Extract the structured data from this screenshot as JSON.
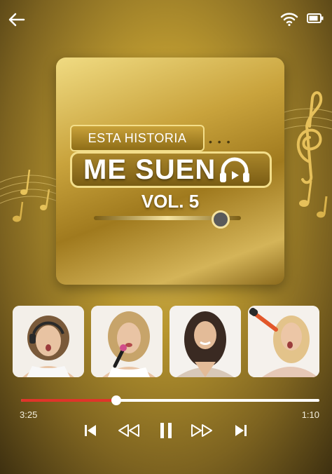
{
  "album": {
    "tag_line": "ESTA HISTORIA",
    "title": "ME SUEN",
    "volume": "VOL. 5"
  },
  "player": {
    "elapsed": "3:25",
    "remaining": "1:10",
    "progress_fraction": 0.32
  },
  "thumbnails": [
    {
      "name": "singer-1",
      "bg": "#f3efe9",
      "hair": "#7a5a3a",
      "accent": "#2a2a2a"
    },
    {
      "name": "singer-2",
      "bg": "#f4f0ea",
      "hair": "#c7a46a",
      "accent": "#1e1e1e"
    },
    {
      "name": "singer-3",
      "bg": "#f5f2ee",
      "hair": "#3a2a22",
      "accent": "#d8c8b8"
    },
    {
      "name": "singer-4",
      "bg": "#f5f1ec",
      "hair": "#e3c38a",
      "accent": "#e2572a"
    }
  ],
  "colors": {
    "progress_fill": "#e0342a",
    "progress_track": "#ffffff",
    "gold": "#c9a33c"
  },
  "icons": [
    "back-arrow-icon",
    "wifi-icon",
    "battery-icon",
    "skip-previous-icon",
    "rewind-icon",
    "pause-icon",
    "fast-forward-icon",
    "skip-next-icon",
    "headphones-icon"
  ]
}
